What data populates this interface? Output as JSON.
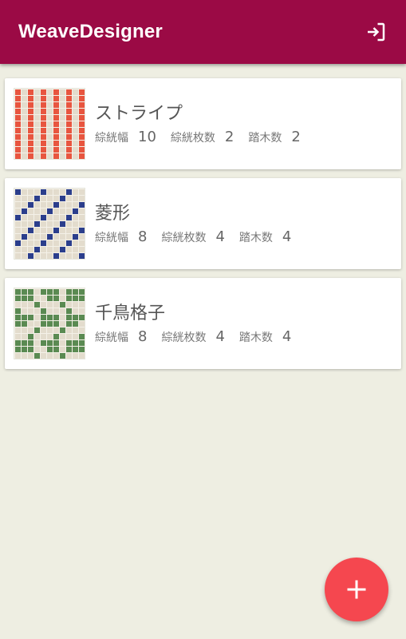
{
  "app": {
    "title": "WeaveDesigner",
    "exit_icon": "logout-icon",
    "bar_color": "#9b0a45"
  },
  "designs": [
    {
      "title": "ストライプ",
      "pattern": "stripe-pattern",
      "warp_color": "#e8553f",
      "stats": [
        {
          "label": "綜絖幅",
          "value": "10"
        },
        {
          "label": "綜絖枚数",
          "value": "2"
        },
        {
          "label": "踏木数",
          "value": "2"
        }
      ]
    },
    {
      "title": "菱形",
      "pattern": "diamond-pattern",
      "warp_color": "#2b3e8c",
      "stats": [
        {
          "label": "綜絖幅",
          "value": "8"
        },
        {
          "label": "綜絖枚数",
          "value": "4"
        },
        {
          "label": "踏木数",
          "value": "4"
        }
      ]
    },
    {
      "title": "千鳥格子",
      "pattern": "houndstooth-pattern",
      "warp_color": "#5a8a52",
      "stats": [
        {
          "label": "綜絖幅",
          "value": "8"
        },
        {
          "label": "綜絖枚数",
          "value": "4"
        },
        {
          "label": "踏木数",
          "value": "4"
        }
      ]
    }
  ],
  "fab": {
    "icon": "plus-icon",
    "color": "#f5474f"
  }
}
